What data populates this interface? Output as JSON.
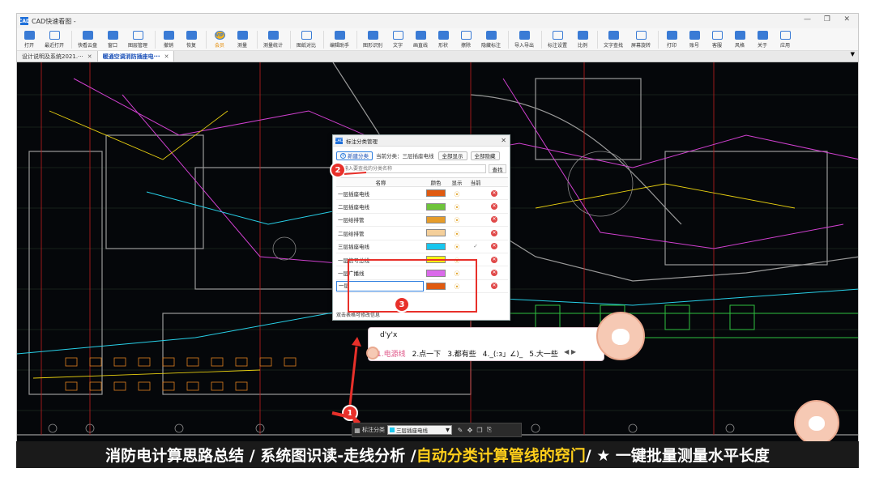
{
  "app": {
    "title": "CAD快速看图 -",
    "window_controls": [
      "—",
      "❐",
      "✕"
    ]
  },
  "toolbar": [
    {
      "label": "打开",
      "icon": "folder-icon"
    },
    {
      "label": "最近打开",
      "icon": "clock-icon"
    },
    {
      "label": "快看云盘",
      "icon": "cloud-icon"
    },
    {
      "label": "窗口",
      "icon": "window-icon"
    },
    {
      "label": "图层管理",
      "icon": "layers-icon"
    },
    {
      "label": "撤销",
      "icon": "undo-icon"
    },
    {
      "label": "恢复",
      "icon": "redo-icon"
    },
    {
      "label": "会员",
      "icon": "vip-icon",
      "vip": true
    },
    {
      "label": "测量",
      "icon": "measure-icon"
    },
    {
      "label": "测量统计",
      "icon": "measure-stats-icon"
    },
    {
      "label": "图纸对比",
      "icon": "compare-icon"
    },
    {
      "label": "编辑助手",
      "icon": "edit-helper-icon"
    },
    {
      "label": "图形识别",
      "icon": "shape-recognize-icon"
    },
    {
      "label": "文字",
      "icon": "text-icon"
    },
    {
      "label": "画直线",
      "icon": "line-icon"
    },
    {
      "label": "形状",
      "icon": "shape-icon"
    },
    {
      "label": "擦除",
      "icon": "eraser-icon"
    },
    {
      "label": "隐藏标注",
      "icon": "hide-annotation-icon"
    },
    {
      "label": "导入导出",
      "icon": "import-export-icon"
    },
    {
      "label": "标注设置",
      "icon": "annotation-settings-icon"
    },
    {
      "label": "比例",
      "icon": "scale-icon"
    },
    {
      "label": "文字查找",
      "icon": "text-search-icon"
    },
    {
      "label": "屏幕旋转",
      "icon": "rotate-icon"
    },
    {
      "label": "打印",
      "icon": "print-icon"
    },
    {
      "label": "账号",
      "icon": "account-icon"
    },
    {
      "label": "客服",
      "icon": "headset-icon"
    },
    {
      "label": "风格",
      "icon": "style-icon"
    },
    {
      "label": "关于",
      "icon": "info-icon"
    },
    {
      "label": "应用",
      "icon": "apps-icon"
    }
  ],
  "tabs": [
    {
      "label": "设计说明及系统2021.··· ",
      "close": "✕",
      "active": false
    },
    {
      "label": "暖通空调消防插座电··· ",
      "close": "✕",
      "active": true
    }
  ],
  "tab_menu": "▼",
  "dialog": {
    "title": "标注分类管理",
    "close": "✕",
    "new_category": "新建分类",
    "current_category": "当前分类：三层插座电线",
    "show_all": "全部显示",
    "hide_all": "全部隐藏",
    "search_placeholder": "请输入要查找的分类名称",
    "search_btn": "查找",
    "columns": [
      "名称",
      "颜色",
      "显示",
      "当前",
      ""
    ],
    "rows": [
      {
        "name": "一层插座电线",
        "color": "#e05a10",
        "current": false
      },
      {
        "name": "二层插座电线",
        "color": "#6ec43a",
        "current": false
      },
      {
        "name": "一层给排管",
        "color": "#e69c2a",
        "current": false
      },
      {
        "name": "二层给排管",
        "color": "#f4cf9a",
        "current": false
      },
      {
        "name": "三层插座电线",
        "color": "#17c6ee",
        "current": true
      },
      {
        "name": "一层信号总线",
        "color": "#f8f512",
        "current": false
      },
      {
        "name": "一层广播线",
        "color": "#da6aea",
        "current": false
      },
      {
        "name": "一层",
        "color": "#e05a10",
        "current": false
      }
    ],
    "show_icon": "⦿",
    "current_icon": "✓",
    "delete_icon": "✕",
    "footer": "双击表格可修改信息"
  },
  "ime": {
    "input": "d'y'x",
    "candidates": [
      "1.电源线",
      "2.点一下",
      "3.都有些",
      "4._(:з」∠)_",
      "5.大一些"
    ],
    "more": "◀ ▶"
  },
  "steps": [
    "1",
    "2",
    "3"
  ],
  "bottombar": {
    "label": "标注分类",
    "selected": "三层插座电线",
    "selected_color": "#1ec8ee"
  },
  "banner": {
    "part1": "消防电计算思路总结 / 系统图识读-走线分析 / ",
    "part2": "自动分类计算管线的窍门",
    "part3": " / ★ 一键批量测量水平长度"
  }
}
